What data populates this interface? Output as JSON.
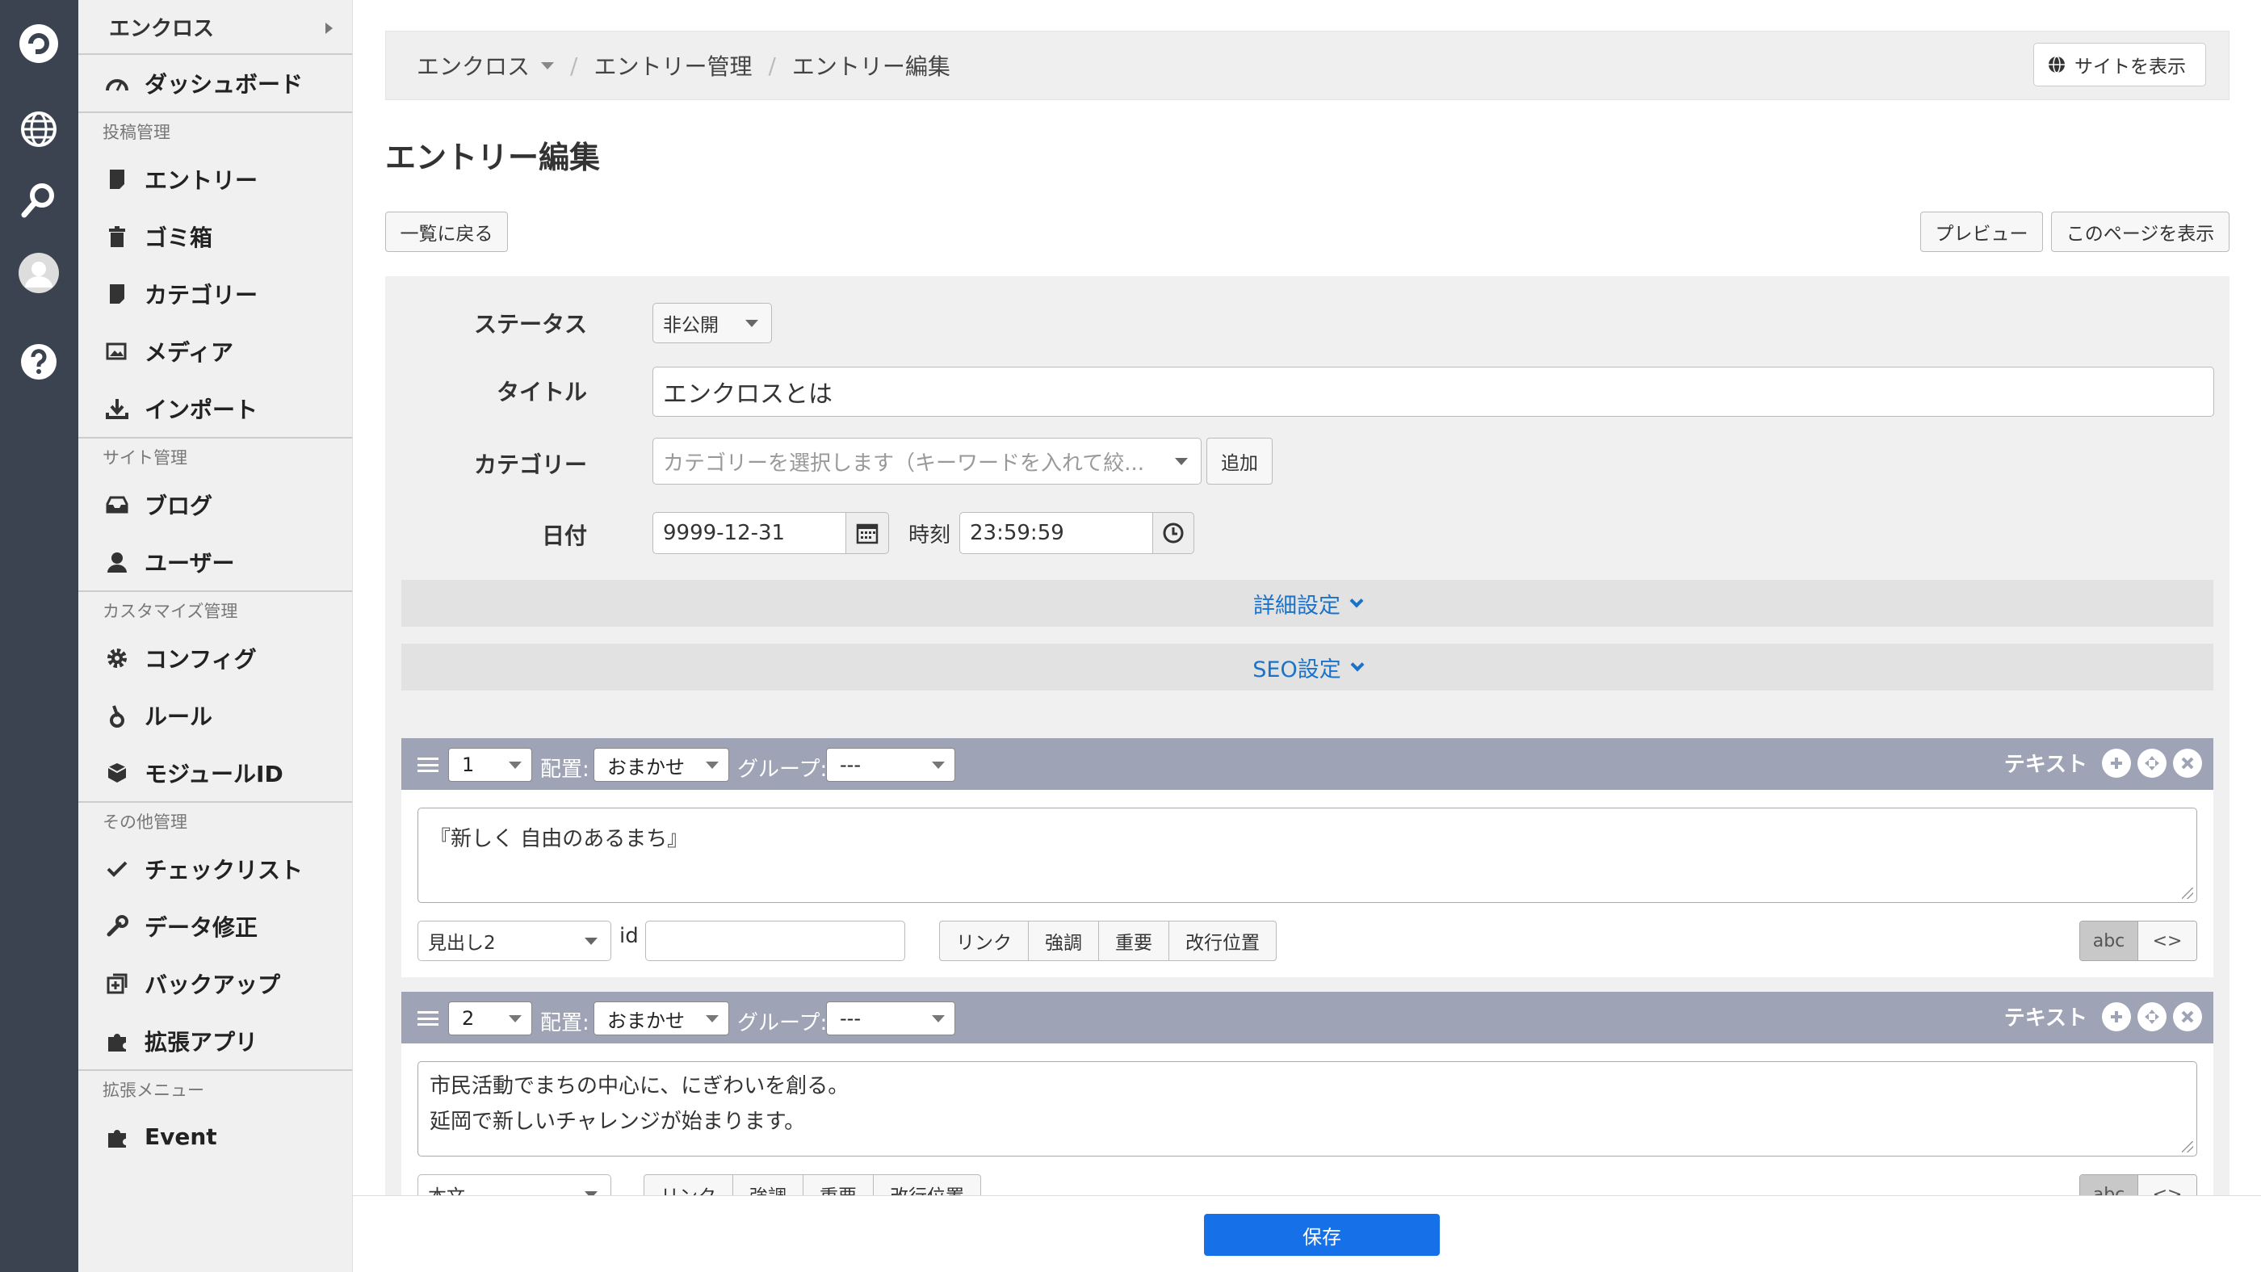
{
  "sidebar": {
    "top_label": "エンクロス",
    "dashboard": "ダッシュボード",
    "groups": [
      {
        "title": "投稿管理",
        "items": [
          "エントリー",
          "ゴミ箱",
          "カテゴリー",
          "メディア",
          "インポート"
        ]
      },
      {
        "title": "サイト管理",
        "items": [
          "ブログ",
          "ユーザー"
        ]
      },
      {
        "title": "カスタマイズ管理",
        "items": [
          "コンフィグ",
          "ルール",
          "モジュールID"
        ]
      },
      {
        "title": "その他管理",
        "items": [
          "チェックリスト",
          "データ修正",
          "バックアップ",
          "拡張アプリ"
        ]
      },
      {
        "title": "拡張メニュー",
        "items": [
          "Event"
        ]
      }
    ]
  },
  "breadcrumb": {
    "items": [
      "エンクロス",
      "エントリー管理",
      "エントリー編集"
    ],
    "site_button": "サイトを表示"
  },
  "page_title": "エントリー編集",
  "buttons": {
    "back": "一覧に戻る",
    "preview": "プレビュー",
    "view_page": "このページを表示",
    "save": "保存"
  },
  "form": {
    "status_label": "ステータス",
    "status_value": "非公開",
    "title_label": "タイトル",
    "title_value": "エンクロスとは",
    "category_label": "カテゴリー",
    "category_placeholder": "カテゴリーを選択します（キーワードを入れて絞...",
    "category_add": "追加",
    "date_label": "日付",
    "date_value": "9999-12-31",
    "time_label": "時刻",
    "time_value": "23:59:59",
    "detail_settings": "詳細設定",
    "seo_settings": "SEO設定"
  },
  "units": [
    {
      "order": "1",
      "placement_label": "配置:",
      "placement": "おまかせ",
      "group_label": "グループ:",
      "group": "---",
      "type_label": "テキスト",
      "text": "『新しく 自由のあるまち』",
      "tag": "見出し2",
      "id_label": "id",
      "id_value": "",
      "tools": [
        "リンク",
        "強調",
        "重要",
        "改行位置"
      ],
      "mode_on": "abc",
      "mode_off": "<>"
    },
    {
      "order": "2",
      "placement_label": "配置:",
      "placement": "おまかせ",
      "group_label": "グループ:",
      "group": "---",
      "type_label": "テキスト",
      "text_line1": "市民活動でまちの中心に、にぎわいを創る。",
      "text_line2": "延岡で新しいチャレンジが始まります。",
      "tag": "本文",
      "tools": [
        "リンク",
        "強調",
        "重要",
        "改行位置"
      ],
      "mode_on": "abc",
      "mode_off": "<>"
    }
  ],
  "colors": {
    "rail": "#3c4350",
    "unit_header": "#9ea3b5",
    "accent_link": "#1a73c9",
    "save": "#1671e8"
  }
}
